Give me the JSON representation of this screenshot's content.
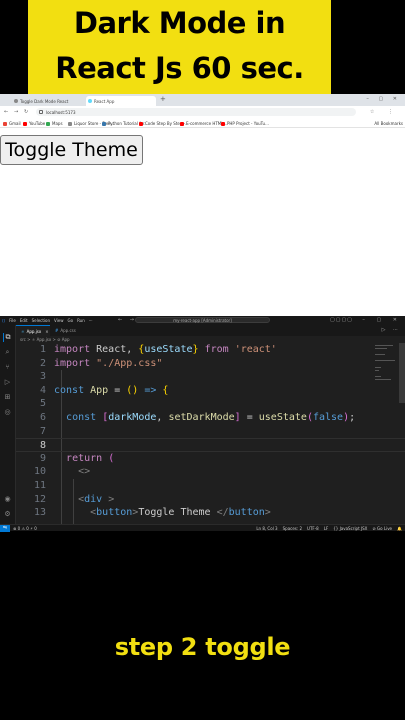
{
  "header": {
    "line1": "Dark Mode in",
    "line2": "React Js 60 sec."
  },
  "browser": {
    "tabs": [
      "Toggle Dark Mode React",
      "React App"
    ],
    "new_tab": "+",
    "window_controls": "– ▢ ✕",
    "nav": {
      "back": "←",
      "forward": "→",
      "reload": "↻"
    },
    "url": "localhost:5173",
    "toolbar_icons": "☆ ⋮",
    "bookmarks": [
      {
        "label": "Gmail",
        "color": "#ea4335"
      },
      {
        "label": "YouTube",
        "color": "#ff0000"
      },
      {
        "label": "Maps",
        "color": "#34a853"
      },
      {
        "label": "Liquor Store - Free...",
        "color": "#888888"
      },
      {
        "label": "Python Tutorial for...",
        "color": "#3776ab"
      },
      {
        "label": "Code Step By Step -...",
        "color": "#ff0000"
      },
      {
        "label": "E-commerce HTML...",
        "color": "#ff0000"
      },
      {
        "label": "PHP Project - YouTu...",
        "color": "#ff0000"
      }
    ],
    "all_bookmarks": "All Bookmarks",
    "page_button": "Toggle Theme"
  },
  "vscode": {
    "menu": [
      "File",
      "Edit",
      "Selection",
      "View",
      "Go",
      "Run",
      "···"
    ],
    "nav_arrows": "← →",
    "search": "my-react-app [Administrator]",
    "layout_icons": "▢▢▢▢",
    "window_controls": "– ▢ ✕",
    "tabs": [
      {
        "label": "App.jsx",
        "active": true
      },
      {
        "label": "App.css",
        "active": false
      }
    ],
    "tab_actions": "▷ ⋯",
    "breadcrumb": "src > ⚛ App.jsx > ⊘ App",
    "current_line": 8,
    "lines": [
      {
        "n": "1",
        "html": "<span class=\"kw\">import</span> React, <span class=\"br1\">{</span><span class=\"var\">useState</span><span class=\"br1\">}</span> <span class=\"kw\">from</span> <span class=\"str\">'react'</span>"
      },
      {
        "n": "2",
        "html": "<span class=\"kw\">import</span> <span class=\"str\">\"./App.css\"</span>"
      },
      {
        "n": "3",
        "html": ""
      },
      {
        "n": "4",
        "html": "<span class=\"kw2\">const</span> <span class=\"fn\">App</span> = <span class=\"br1\">()</span> <span class=\"kw2\">=&gt;</span> <span class=\"br1\">{</span>"
      },
      {
        "n": "5",
        "html": ""
      },
      {
        "n": "6",
        "html": "  <span class=\"kw2\">const</span> <span class=\"br2\">[</span><span class=\"var\">darkMode</span>, <span class=\"fn\">setDarkMode</span><span class=\"br2\">]</span> = <span class=\"fn\">useState</span><span class=\"br2\">(</span><span class=\"bool\">false</span><span class=\"br2\">)</span>;"
      },
      {
        "n": "7",
        "html": ""
      },
      {
        "n": "8",
        "html": ""
      },
      {
        "n": "9",
        "html": "  <span class=\"kw\">return</span> <span class=\"br2\">(</span>"
      },
      {
        "n": "10",
        "html": "    <span class=\"tagp\">&lt;&gt;</span>"
      },
      {
        "n": "11",
        "html": ""
      },
      {
        "n": "12",
        "html": "    <span class=\"tagp\">&lt;</span><span class=\"tag\">div</span> <span class=\"tagp\">&gt;</span>"
      },
      {
        "n": "13",
        "html": "      <span class=\"tagp\">&lt;</span><span class=\"tag\">button</span><span class=\"tagp\">&gt;</span>Toggle Theme <span class=\"tagp\">&lt;/</span><span class=\"tag\">button</span><span class=\"tagp\">&gt;</span>"
      }
    ],
    "status": {
      "left": "⊗ 0 ⚠ 0   ⚡ 0",
      "items": [
        "Ln 8, Col 3",
        "Spaces: 2",
        "UTF-8",
        "LF",
        "{} JavaScript JSX",
        "⊘ Go Live",
        "🔔"
      ]
    }
  },
  "footer": "step 2 toggle"
}
